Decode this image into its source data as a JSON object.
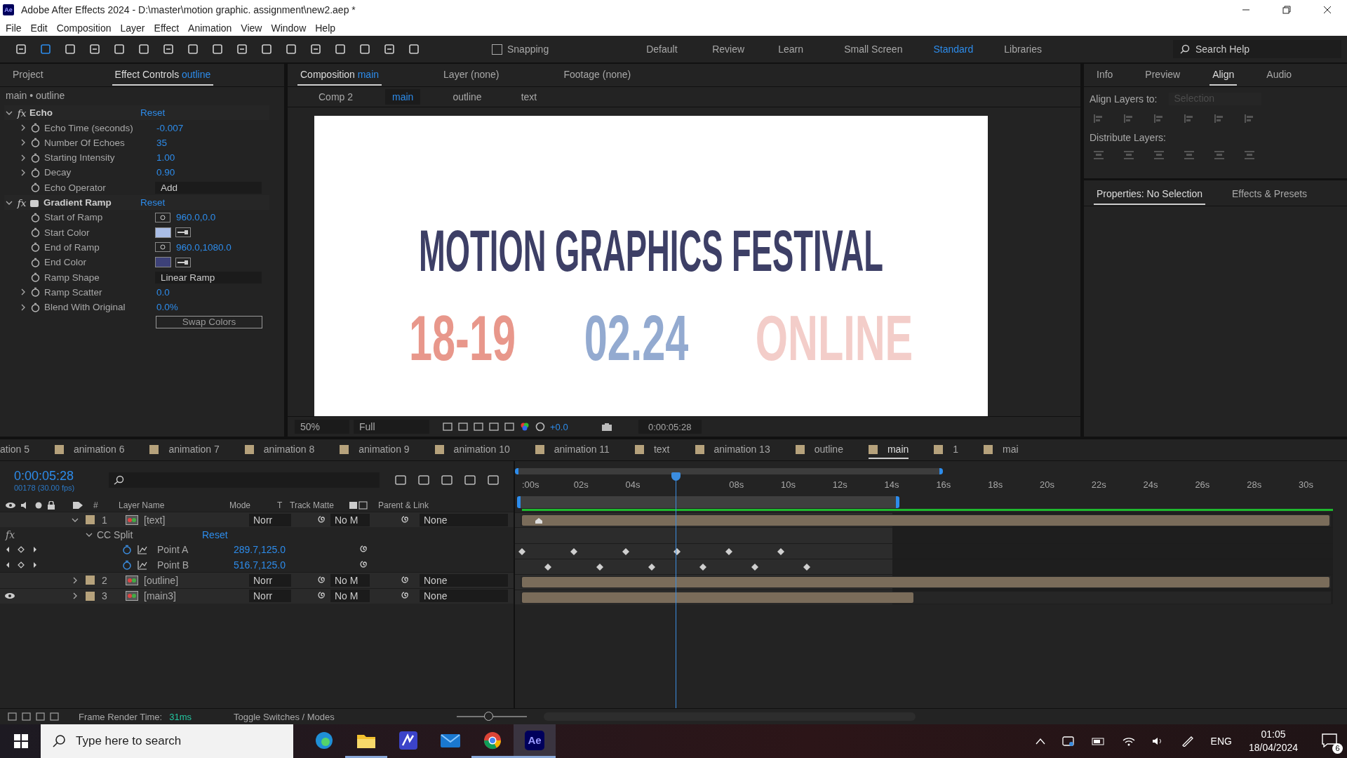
{
  "window": {
    "app_icon": "Ae",
    "title": "Adobe After Effects 2024 - D:\\master\\motion graphic. assignment\\new2.aep *"
  },
  "menu": [
    "File",
    "Edit",
    "Composition",
    "Layer",
    "Effect",
    "Animation",
    "View",
    "Window",
    "Help"
  ],
  "toolbar": {
    "snapping": {
      "label": "Snapping",
      "checked": false
    },
    "workspaces": [
      {
        "label": "Default",
        "selected": false
      },
      {
        "label": "Review",
        "selected": false
      },
      {
        "label": "Learn",
        "selected": false
      },
      {
        "label": "Small Screen",
        "selected": false
      },
      {
        "label": "Standard",
        "selected": true
      },
      {
        "label": "Libraries",
        "selected": false
      }
    ],
    "search": {
      "placeholder": "Search Help"
    }
  },
  "effect_panel": {
    "tabs": [
      {
        "label": "Project",
        "selected": false
      },
      {
        "label": "Effect Controls",
        "layer": "outline",
        "selected": true
      }
    ],
    "breadcrumb": "main • outline",
    "effects": [
      {
        "name": "Echo",
        "fx": "fx",
        "reset": "Reset",
        "has_icon": false,
        "properties": [
          {
            "kind": "number",
            "name": "Echo Time (seconds)",
            "value": "-0.007",
            "expandable": true
          },
          {
            "kind": "number",
            "name": "Number Of Echoes",
            "value": "35",
            "expandable": true
          },
          {
            "kind": "number",
            "name": "Starting Intensity",
            "value": "1.00",
            "expandable": true
          },
          {
            "kind": "number",
            "name": "Decay",
            "value": "0.90",
            "expandable": true
          },
          {
            "kind": "dropdown",
            "name": "Echo Operator",
            "value": "Add",
            "expandable": false
          }
        ]
      },
      {
        "name": "Gradient Ramp",
        "fx": "fx",
        "reset": "Reset",
        "has_icon": true,
        "properties": [
          {
            "kind": "point",
            "name": "Start of Ramp",
            "value": "960.0,0.0",
            "expandable": false
          },
          {
            "kind": "color",
            "name": "Start Color",
            "color": "#a9bde6",
            "expandable": false
          },
          {
            "kind": "point",
            "name": "End of Ramp",
            "value": "960.0,1080.0",
            "expandable": false
          },
          {
            "kind": "color",
            "name": "End Color",
            "color": "#3d4178",
            "expandable": false
          },
          {
            "kind": "dropdown",
            "name": "Ramp Shape",
            "value": "Linear Ramp",
            "expandable": false
          },
          {
            "kind": "number",
            "name": "Ramp Scatter",
            "value": "0.0",
            "expandable": true
          },
          {
            "kind": "number",
            "name": "Blend With Original",
            "value": "0.0%",
            "expandable": true
          }
        ]
      }
    ],
    "swap_button": "Swap Colors"
  },
  "composition": {
    "tabs": [
      {
        "label": "Composition",
        "name": "main",
        "selected": true
      },
      {
        "label": "Layer",
        "name": "(none)",
        "selected": false
      },
      {
        "label": "Footage",
        "name": "(none)",
        "selected": false
      }
    ],
    "breadcrumb": [
      {
        "label": "Comp 2",
        "selected": false
      },
      {
        "label": "main",
        "selected": true
      },
      {
        "label": "outline",
        "selected": false
      },
      {
        "label": "text",
        "selected": false
      }
    ],
    "canvas": {
      "title": {
        "text": "MOTION GRAPHICS FESTIVAL",
        "color": "#3d3f66"
      },
      "items": [
        {
          "text": "18-19",
          "color": "#e8978b"
        },
        {
          "text": "02.24",
          "color": "#93aad0"
        },
        {
          "text": "ONLINE",
          "color": "#f3cdc9"
        }
      ]
    },
    "viewer_bar": {
      "zoom": "50%",
      "resolution": "Full",
      "exposure": "+0.0",
      "timecode": "0:00:05:28"
    }
  },
  "right_panel": {
    "tabs": [
      {
        "label": "Info",
        "selected": false
      },
      {
        "label": "Preview",
        "selected": false
      },
      {
        "label": "Align",
        "selected": true
      },
      {
        "label": "Audio",
        "selected": false
      }
    ],
    "align_label": "Align Layers to:",
    "align_to": "Selection",
    "distribute_label": "Distribute Layers:",
    "lower_tabs": [
      {
        "label": "Properties: No Selection",
        "selected": true
      },
      {
        "label": "Effects & Presets",
        "selected": false
      }
    ]
  },
  "timeline": {
    "tabs": [
      {
        "label": "ation 5",
        "selected": false
      },
      {
        "label": "animation 6",
        "selected": false
      },
      {
        "label": "animation 7",
        "selected": false
      },
      {
        "label": "animation 8",
        "selected": false
      },
      {
        "label": "animation 9",
        "selected": false
      },
      {
        "label": "animation 10",
        "selected": false
      },
      {
        "label": "animation 11",
        "selected": false
      },
      {
        "label": "text",
        "selected": false
      },
      {
        "label": "animation 13",
        "selected": false
      },
      {
        "label": "outline",
        "selected": false
      },
      {
        "label": "main",
        "selected": true
      },
      {
        "label": "1",
        "selected": false
      },
      {
        "label": "mai",
        "selected": false
      }
    ],
    "timecode": "0:00:05:28",
    "frames": "00178 (30.00 fps)",
    "columns": {
      "index": "#",
      "name": "Layer Name",
      "mode": "Mode",
      "t": "T",
      "matte": "Track Matte",
      "parent": "Parent & Link"
    },
    "ruler": [
      ":00s",
      "02s",
      "04s",
      "08s",
      "10s",
      "12s",
      "14s",
      "16s",
      "18s",
      "20s",
      "22s",
      "24s",
      "26s",
      "28s",
      "30s"
    ],
    "layers": [
      {
        "index": "1",
        "name": "[text]",
        "mode": "Norr",
        "matte": "No M",
        "parent": "None",
        "visible": false,
        "expanded": true,
        "level": 1,
        "effect": {
          "fx": "fx",
          "name": "CC Split",
          "reset": "Reset",
          "properties": [
            {
              "name": "Point A",
              "value": "289.7,125.0"
            },
            {
              "name": "Point B",
              "value": "516.7,125.0"
            }
          ]
        }
      },
      {
        "index": "2",
        "name": "[outline]",
        "mode": "Norr",
        "matte": "No M",
        "parent": "None",
        "visible": false,
        "expanded": false,
        "level": 1
      },
      {
        "index": "3",
        "name": "[main3]",
        "mode": "Norr",
        "matte": "No M",
        "parent": "None",
        "visible": true,
        "expanded": false,
        "level": 0.485
      }
    ],
    "footer": {
      "zoom": {
        "level": 0.45
      },
      "render_label": "Frame Render Time:",
      "render_time": "31ms",
      "toggle": "Toggle Switches / Modes"
    }
  },
  "taskbar": {
    "search": {
      "placeholder": "Type here to search"
    },
    "apps": [
      {
        "kind": "edge",
        "running": false,
        "selected": false
      },
      {
        "kind": "folder",
        "running": true,
        "selected": false
      },
      {
        "kind": "app",
        "running": false,
        "selected": false
      },
      {
        "kind": "mail",
        "running": false,
        "selected": false
      },
      {
        "kind": "chrome",
        "running": true,
        "selected": false
      },
      {
        "kind": "ae",
        "label": "Ae",
        "running": true,
        "selected": true
      }
    ],
    "language": "ENG",
    "time": "01:05",
    "date": "18/04/2024",
    "notifications": "6"
  }
}
